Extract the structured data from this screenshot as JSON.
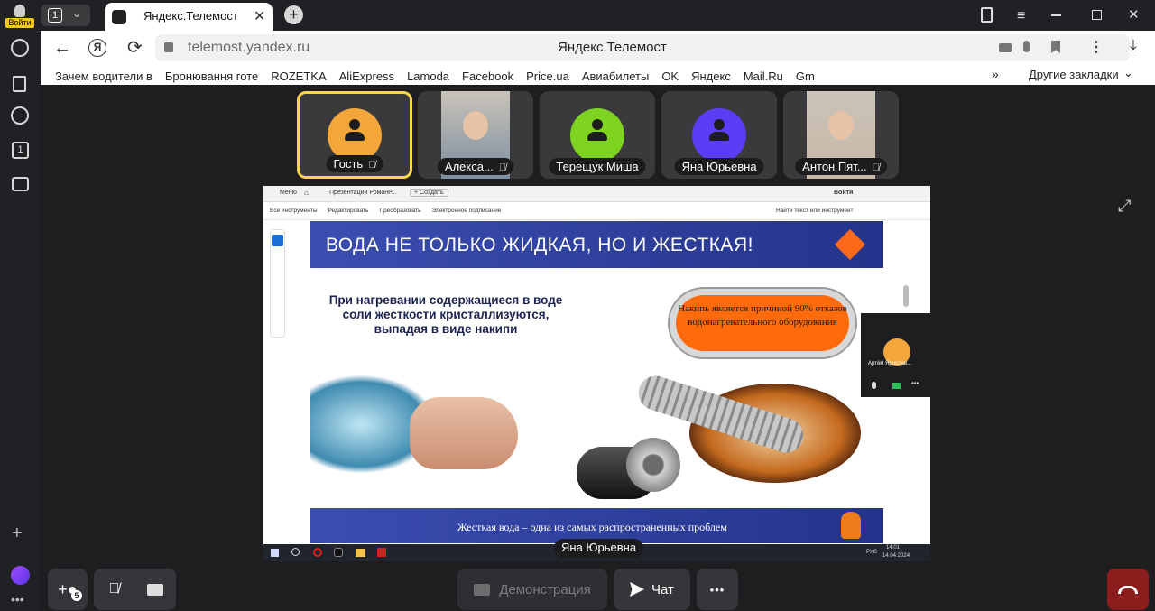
{
  "browser": {
    "login_label": "Войти",
    "tab_count": "1",
    "tab_title": "Яндекс.Телемост",
    "url": "telemost.yandex.ru",
    "page_title": "Яндекс.Телемост",
    "bookmarks": [
      "Зачем водители в",
      "Бронювання готе",
      "ROZETKA",
      "AliExpress",
      "Lamoda",
      "Facebook",
      "Price.ua",
      "Авиабилеты",
      "OK",
      "Яндекс",
      "Mail.Ru",
      "Gm"
    ],
    "bookmarks_more": "»",
    "other_bookmarks": "Другие закладки",
    "sidebar_badge": "1"
  },
  "participants": [
    {
      "name": "Гость",
      "avatar_color": "#f3a63a",
      "active": true,
      "muted": true
    },
    {
      "name": "Алекса...",
      "avatar_color": "#7c8ea0",
      "active": false,
      "muted": true,
      "video": true
    },
    {
      "name": "Терещук Миша",
      "avatar_color": "#7ed321",
      "active": false,
      "muted": false
    },
    {
      "name": "Яна Юрьевна",
      "avatar_color": "#5b3df5",
      "active": false,
      "muted": false
    },
    {
      "name": "Антон Пят...",
      "avatar_color": "#c9b8a8",
      "active": false,
      "muted": true,
      "video": true
    }
  ],
  "share": {
    "presenter": "Яна Юрьевна",
    "app": {
      "menu": "Меню",
      "tab": "Презентации РоманР...",
      "new_tab": "+ Создать",
      "login": "Войти",
      "tools": [
        "Все инструменты",
        "Редактировать",
        "Преобразовать",
        "Электронное подписание"
      ],
      "search": "Найти текст или инструмент"
    },
    "slide": {
      "title": "ВОДА НЕ ТОЛЬКО ЖИДКАЯ, НО И ЖЕСТКАЯ!",
      "body": "При нагревании содержащиеся в воде соли жесткости кристаллизуются, выпадая в виде накипи",
      "callout": "Накипь является причиной 90% отказов водонагревательного оборудования",
      "footer": "Жесткая вода – одна из самых распространенных проблем"
    },
    "mini_window": {
      "name": "Артём Ярослав..."
    },
    "taskbar": {
      "time": "14:01",
      "date": "14.04.2024",
      "lang": "РУС"
    }
  },
  "controls": {
    "invite_count": "5",
    "demo_label": "Демонстрация",
    "chat_label": "Чат",
    "more_label": "•••"
  },
  "colors": {
    "accent": "#ffd54a",
    "slide_blue": "#2c3a8a",
    "hangup": "#8b1d1d"
  }
}
